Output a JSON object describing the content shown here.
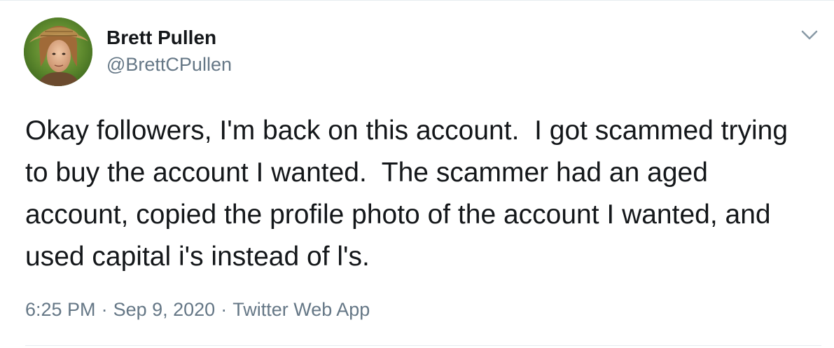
{
  "author": {
    "display_name": "Brett Pullen",
    "handle": "@BrettCPullen",
    "avatar_icon": "profile-photo"
  },
  "tweet": {
    "text": "Okay followers, I'm back on this account.  I got scammed trying to buy the account I wanted.  The scammer had an aged account, copied the profile photo of the account I wanted, and used capital i's instead of l's."
  },
  "meta": {
    "time": "6:25 PM",
    "separator": "·",
    "date": "Sep 9, 2020",
    "source": "Twitter Web App"
  },
  "menu": {
    "icon": "chevron-down-icon"
  },
  "colors": {
    "text_primary": "#14171a",
    "text_secondary": "#657786",
    "border": "#e6ecf0",
    "caret": "#657786"
  }
}
